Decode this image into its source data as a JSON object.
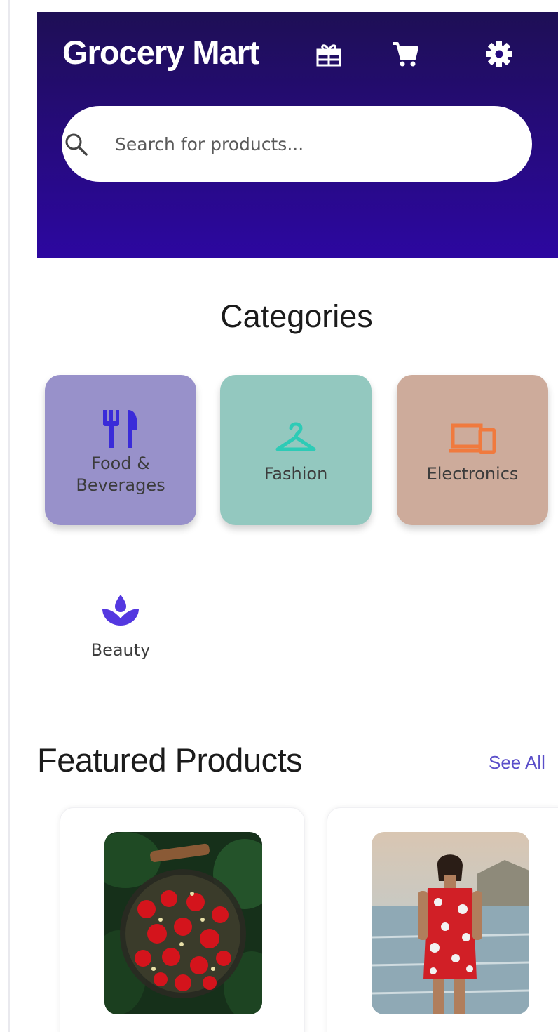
{
  "header": {
    "title": "Grocery Mart",
    "icons": [
      "gift-icon",
      "cart-icon",
      "gear-icon"
    ],
    "colors": {
      "gradient_top": "#1e0f55",
      "gradient_bottom": "#2c07a0"
    }
  },
  "search": {
    "placeholder": "Search for products...",
    "value": ""
  },
  "categories": {
    "title": "Categories",
    "items": [
      {
        "label_line1": "Food &",
        "label_line2": "Beverages",
        "icon": "fork-knife-icon",
        "color": "#9891ca",
        "icon_color": "#3a2bd9"
      },
      {
        "label": "Fashion",
        "icon": "hanger-icon",
        "color": "#93c8bf",
        "icon_color": "#2dcbb6"
      },
      {
        "label": "Electronics",
        "icon": "devices-icon",
        "color": "#cdab9b",
        "icon_color": "#f07a3e"
      },
      {
        "label": "Beauty",
        "icon": "spa-icon",
        "color": "#ffffff",
        "icon_color": "#5438e0"
      }
    ]
  },
  "featured": {
    "title": "Featured Products",
    "see_all": "See All",
    "products": [
      {
        "image": "strawberries-basket-image"
      },
      {
        "image": "woman-red-dress-beach-image"
      }
    ]
  }
}
